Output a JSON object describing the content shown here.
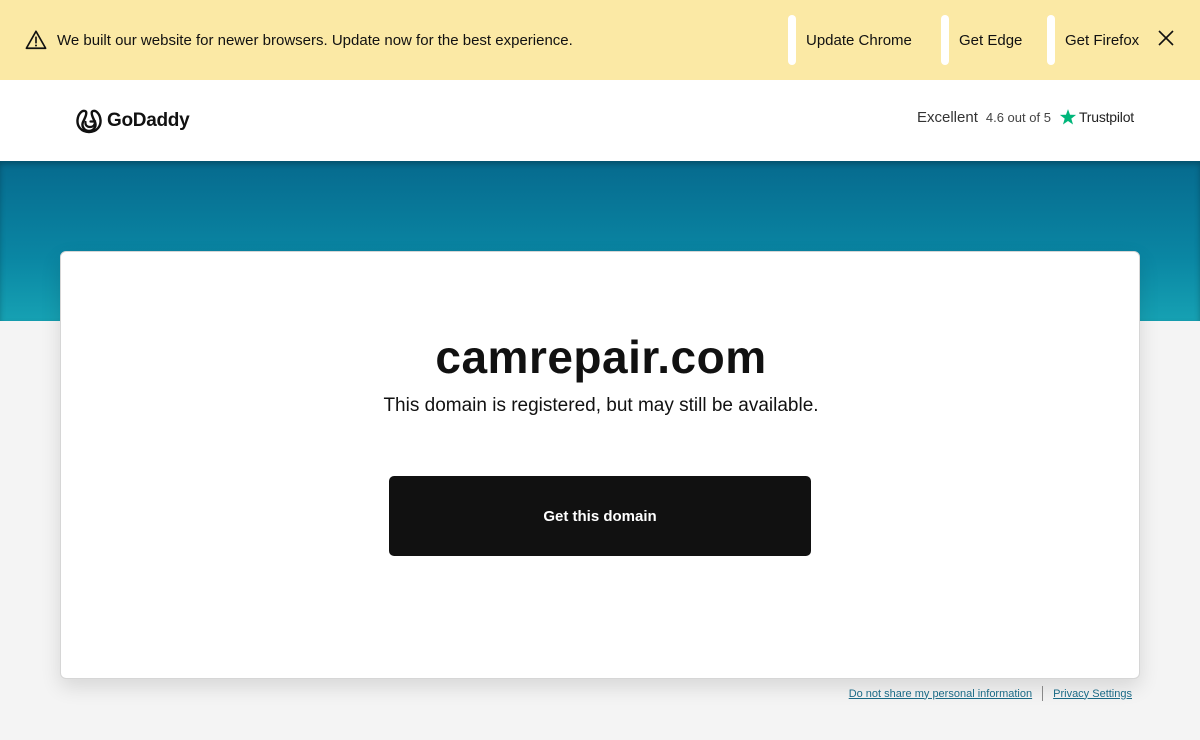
{
  "banner": {
    "message": "We built our website for newer browsers. Update now for the best experience.",
    "browsers": [
      {
        "label": "Update Chrome"
      },
      {
        "label": "Get Edge"
      },
      {
        "label": "Get Firefox"
      }
    ],
    "background": "#fbe9a5"
  },
  "header": {
    "logo_text": "GoDaddy",
    "rating": {
      "label": "Excellent",
      "score": "4.6 out of 5",
      "provider": "Trustpilot",
      "star_color": "#00b67a"
    }
  },
  "main": {
    "domain": "camrepair.com",
    "subtitle": "This domain is registered, but may still be available.",
    "cta_label": "Get this domain"
  },
  "footer": {
    "links": [
      {
        "label": "Do not share my personal information"
      },
      {
        "label": "Privacy Settings"
      }
    ]
  },
  "colors": {
    "hero_top": "#066a8e",
    "hero_bottom": "#16a1b3",
    "cta_bg": "#111111",
    "link": "#1a6a86"
  }
}
